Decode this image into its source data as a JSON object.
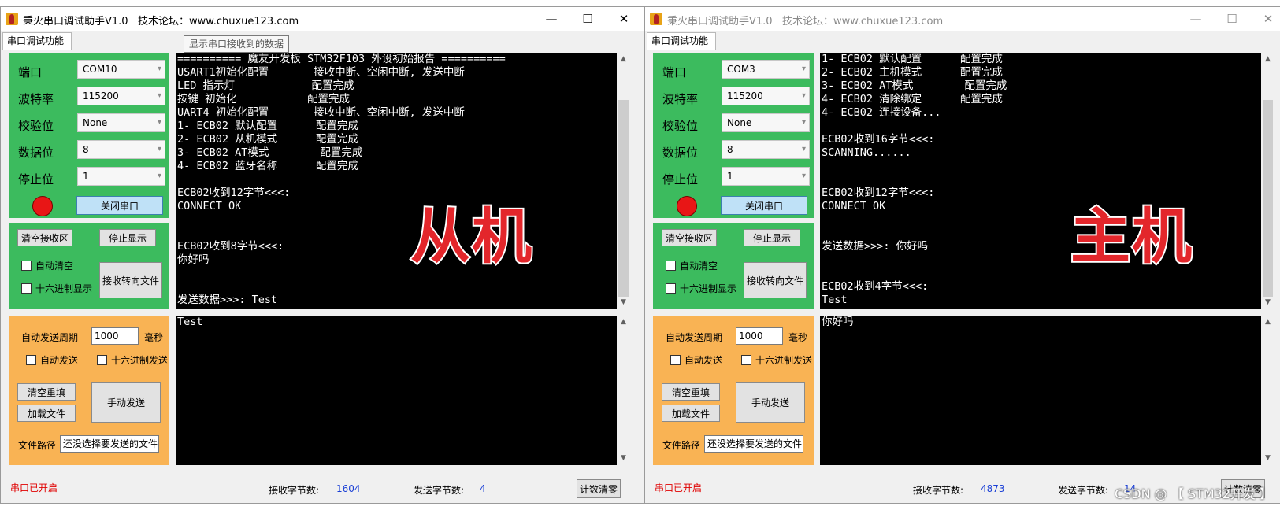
{
  "common": {
    "forum_text": "技术论坛：www.chuxue123.com",
    "tab_label": "串口调试功能",
    "labels": {
      "port": "端口",
      "baud": "波特率",
      "parity": "校验位",
      "data_bits": "数据位",
      "stop_bits": "停止位"
    },
    "close_port_button": "关闭串口",
    "clear_receive_button": "清空接收区",
    "stop_display_button": "停止显示",
    "auto_clear_label": "自动清空",
    "hex_display_label": "十六进制显示",
    "redirect_file_button": "接收转向文件",
    "auto_send_period_label": "自动发送周期",
    "period_value": "1000",
    "period_unit": "毫秒",
    "auto_send_label": "自动发送",
    "hex_send_label": "十六进制发送",
    "clear_resend_button": "清空重填",
    "load_file_button": "加载文件",
    "manual_send_button": "手动发送",
    "file_path_label": "文件路径",
    "file_path_value": "还没选择要发送的文件",
    "port_status": "串口已开启",
    "rx_count_label": "接收字节数:",
    "tx_count_label": "发送字节数:",
    "clear_count_button": "计数清零",
    "colors": {
      "green_panel": "#3cbb5e",
      "orange_panel": "#f9b354",
      "led": "#e81616",
      "big_label": "#e3262b"
    },
    "icons": [
      "app-icon",
      "minimize-icon",
      "maximize-icon",
      "close-icon",
      "chevron-down-icon",
      "scroll-up-icon",
      "scroll-down-icon"
    ]
  },
  "left": {
    "title": "秉火串口调试助手V1.0",
    "tooltip": "显示串口接收到的数据",
    "port": "COM10",
    "baud": "115200",
    "parity": "None",
    "data_bits": "8",
    "stop_bits": "1",
    "receive_lines": [
      "========== 魔友开发板 STM32F103 外设初始报告 ==========",
      "USART1初始化配置       接收中断、空闲中断, 发送中断",
      "LED 指示灯            配置完成",
      "按键 初始化           配置完成",
      "UART4 初始化配置       接收中断、空闲中断, 发送中断",
      "1- ECB02 默认配置      配置完成",
      "2- ECB02 从机模式      配置完成",
      "3- ECB02 AT模式        配置完成",
      "4- ECB02 蓝牙名称      配置完成",
      "",
      "ECB02收到12字节<<<:",
      "CONNECT OK",
      "",
      "",
      "ECB02收到8字节<<<:",
      "你好吗",
      "",
      "",
      "发送数据>>>: Test"
    ],
    "send_text": "Test",
    "big_label": "从机",
    "rx_count": "1604",
    "tx_count": "4"
  },
  "right": {
    "title": "秉火串口调试助手V1.0",
    "port": "COM3",
    "baud": "115200",
    "parity": "None",
    "data_bits": "8",
    "stop_bits": "1",
    "receive_lines": [
      "1- ECB02 默认配置      配置完成",
      "2- ECB02 主机模式      配置完成",
      "3- ECB02 AT模式        配置完成",
      "4- ECB02 清除绑定      配置完成",
      "4- ECB02 连接设备...",
      "",
      "ECB02收到16字节<<<:",
      "SCANNING......",
      "",
      "",
      "ECB02收到12字节<<<:",
      "CONNECT OK",
      "",
      "",
      "发送数据>>>: 你好吗",
      "",
      "",
      "ECB02收到4字节<<<:",
      "Test"
    ],
    "send_text": "你好吗",
    "big_label": "主机",
    "rx_count": "4873",
    "tx_count": "14"
  },
  "watermark": "CSDN @ 【 STM32开发 】"
}
